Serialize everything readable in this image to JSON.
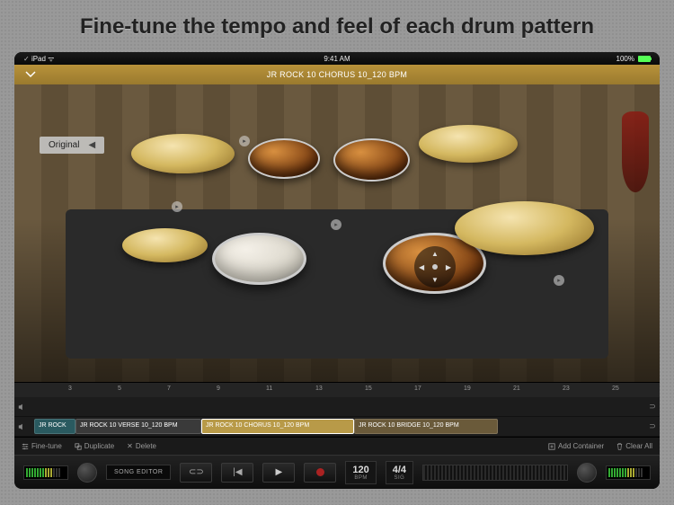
{
  "headline": "Fine-tune the tempo and feel of each drum pattern",
  "status": {
    "time": "9:41 AM",
    "carrier": "iPad",
    "battery": "100%"
  },
  "topbar": {
    "title": "JR ROCK 10 CHORUS 10_120 BPM"
  },
  "kit_picker": {
    "label": "Original"
  },
  "ruler_ticks": [
    "3",
    "5",
    "7",
    "9",
    "11",
    "13",
    "15",
    "17",
    "19",
    "21",
    "23",
    "25"
  ],
  "clips": {
    "a": "JR ROCK",
    "b": "JR ROCK 10 VERSE 10_120 BPM",
    "c": "JR ROCK 10 CHORUS 10_120 BPM",
    "d": "JR ROCK 10 BRIDGE 10_120 BPM"
  },
  "toolbar": {
    "finetune": "Fine-tune",
    "duplicate": "Duplicate",
    "delete": "Delete",
    "add_container": "Add Container",
    "clear_all": "Clear All"
  },
  "transport": {
    "mode": "SONG EDITOR",
    "bpm_value": "120",
    "bpm_label": "BPM",
    "sig_value": "4/4",
    "sig_label": "SIG"
  }
}
